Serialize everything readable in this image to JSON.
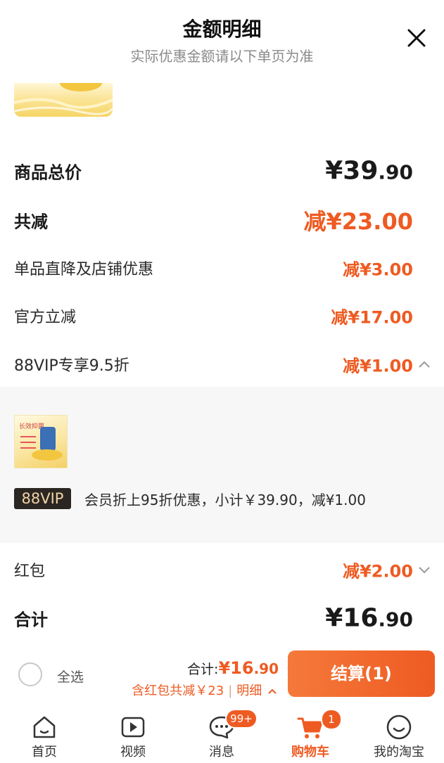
{
  "header": {
    "title": "金额明细",
    "subtitle": "实际优惠金额请以下单页为准"
  },
  "rows": {
    "total": {
      "label": "商品总价",
      "currency": "¥",
      "main": "39",
      "dec": ".90"
    },
    "discount": {
      "label": "共减",
      "value": "减¥23.00"
    },
    "store": {
      "label": "单品直降及店铺优惠",
      "value": "减¥3.00"
    },
    "official": {
      "label": "官方立减",
      "value": "减¥17.00"
    },
    "vip": {
      "label": "88VIP专享9.5折",
      "value": "减¥1.00"
    },
    "redpacket": {
      "label": "红包",
      "value": "减¥2.00"
    },
    "sum": {
      "label": "合计",
      "currency": "¥",
      "main": "16",
      "dec": ".90"
    }
  },
  "vip_panel": {
    "badge": "88VIP",
    "text": "会员折上95折优惠，小计￥39.90，减¥1.00",
    "thumb_text": "长效抑菌"
  },
  "bottom_bar": {
    "select_all": "全选",
    "total_label": "合计:",
    "total_currency": "¥",
    "total_main": "16",
    "total_dec": ".90",
    "sub_text": "含红包共减￥23",
    "sep": "|",
    "detail": "明细",
    "pay_button": "结算(1)"
  },
  "tabs": [
    {
      "label": "首页",
      "icon": "home-icon"
    },
    {
      "label": "视频",
      "icon": "video-icon"
    },
    {
      "label": "消息",
      "icon": "message-icon",
      "badge": "99+"
    },
    {
      "label": "购物车",
      "icon": "cart-icon",
      "badge": "1",
      "active": true
    },
    {
      "label": "我的淘宝",
      "icon": "smile-icon"
    }
  ],
  "colors": {
    "accent": "#ee5b22",
    "vip_bg": "#2b2622",
    "vip_text": "#f0d3a6"
  }
}
